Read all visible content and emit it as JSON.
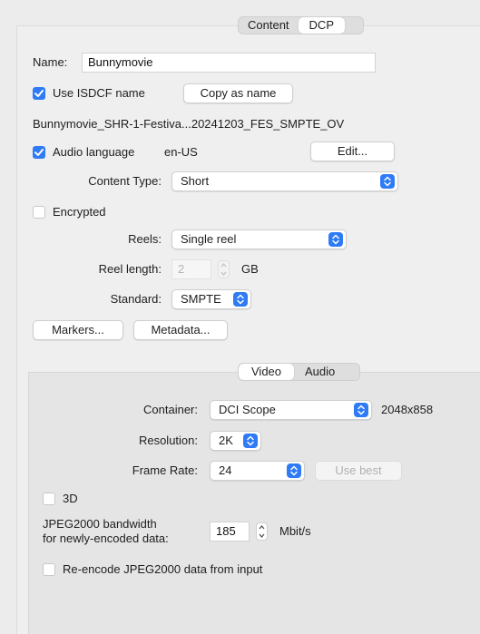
{
  "top_tabs": {
    "content": "Content",
    "dcp": "DCP",
    "selected": "DCP"
  },
  "name": {
    "label": "Name:",
    "value": "Bunnymovie"
  },
  "isdcf": {
    "label": "Use ISDCF name",
    "checked": true,
    "copy_button": "Copy as name"
  },
  "dcp_name": "Bunnymovie_SHR-1-Festiva...20241203_FES_SMPTE_OV",
  "audio_language": {
    "label": "Audio language",
    "checked": true,
    "value": "en-US",
    "edit_button": "Edit..."
  },
  "content_type": {
    "label": "Content Type:",
    "value": "Short"
  },
  "encrypted": {
    "label": "Encrypted",
    "checked": false
  },
  "reels": {
    "label": "Reels:",
    "value": "Single reel"
  },
  "reel_length": {
    "label": "Reel length:",
    "value": "2",
    "unit": "GB",
    "enabled": false
  },
  "standard": {
    "label": "Standard:",
    "value": "SMPTE"
  },
  "buttons": {
    "markers": "Markers...",
    "metadata": "Metadata..."
  },
  "sub_tabs": {
    "video": "Video",
    "audio": "Audio",
    "selected": "Video"
  },
  "container": {
    "label": "Container:",
    "value": "DCI Scope",
    "size": "2048x858"
  },
  "resolution": {
    "label": "Resolution:",
    "value": "2K"
  },
  "frame_rate": {
    "label": "Frame Rate:",
    "value": "24",
    "use_best": "Use best",
    "use_best_enabled": false
  },
  "three_d": {
    "label": "3D",
    "checked": false
  },
  "bandwidth": {
    "label_line1": "JPEG2000 bandwidth",
    "label_line2": "for newly-encoded data:",
    "value": "185",
    "unit": "Mbit/s"
  },
  "reencode": {
    "label": "Re-encode JPEG2000 data from input",
    "checked": false
  },
  "colors": {
    "accent": "#2f7bf6",
    "window_bg": "#ececec"
  }
}
